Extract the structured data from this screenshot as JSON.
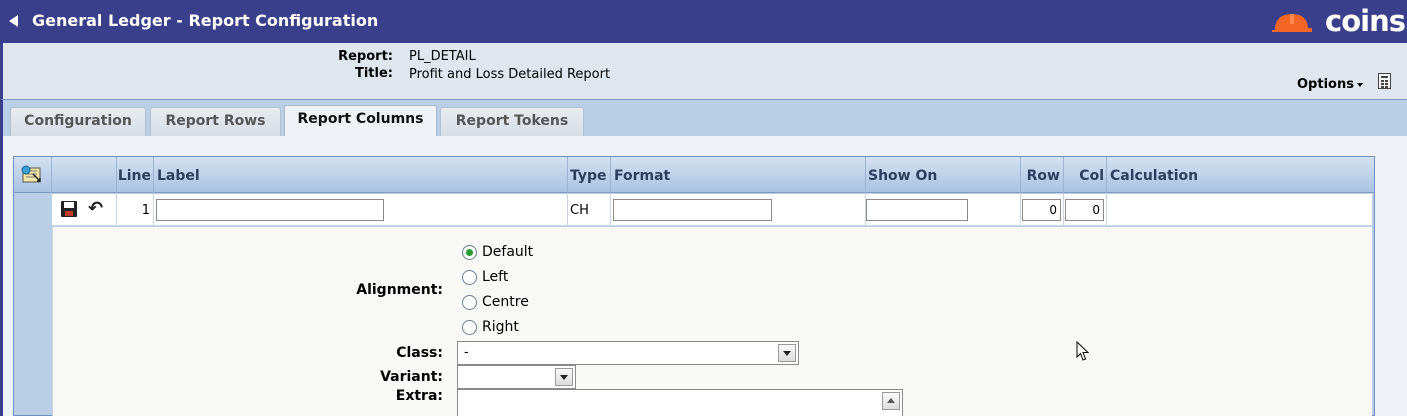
{
  "header": {
    "title": "General Ledger - Report Configuration",
    "logo_text": "coins",
    "colors": {
      "titlebar": "#3a3f8c",
      "infobar": "#dfe6ee",
      "tabbar": "#b9cfe6",
      "accent_green": "#2b9a2f"
    }
  },
  "report_info": {
    "report_label": "Report:",
    "report_value": "PL_DETAIL",
    "title_label": "Title:",
    "title_value": "Profit and Loss Detailed Report",
    "options_label": "Options"
  },
  "tabs": [
    {
      "label": "Configuration",
      "active": false
    },
    {
      "label": "Report Rows",
      "active": false
    },
    {
      "label": "Report Columns",
      "active": true
    },
    {
      "label": "Report Tokens",
      "active": false
    }
  ],
  "grid": {
    "columns": [
      "Line",
      "Label",
      "Type",
      "Format",
      "Show On",
      "Row",
      "Col",
      "Calculation"
    ],
    "row": {
      "line": "1",
      "label": "",
      "type": "CH",
      "format": "",
      "show_on": "",
      "row": "0",
      "col": "0",
      "calculation": ""
    }
  },
  "detail": {
    "alignment_label": "Alignment:",
    "alignment_options": [
      "Default",
      "Left",
      "Centre",
      "Right"
    ],
    "alignment_selected": "Default",
    "class_label": "Class:",
    "class_value": "-",
    "variant_label": "Variant:",
    "variant_value": "",
    "extra_label": "Extra:"
  }
}
